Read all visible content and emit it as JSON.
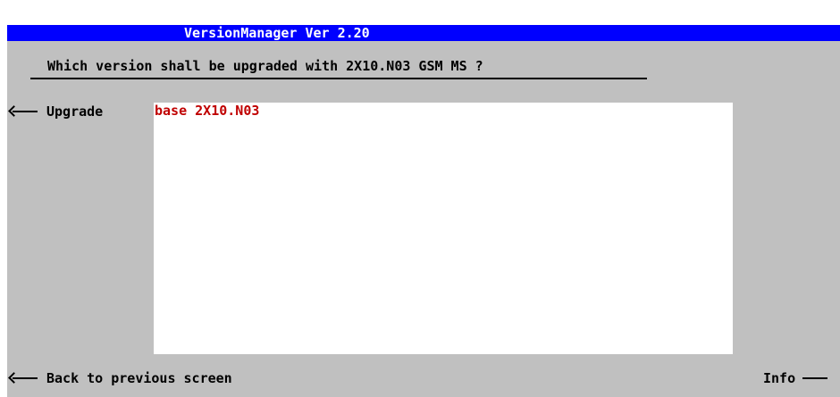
{
  "window": {
    "title": "VersionManager Ver 2.20"
  },
  "prompt": {
    "question": "Which version shall be upgraded with 2X10.N03 GSM MS ?"
  },
  "softkeys": {
    "upgrade_label": "Upgrade",
    "back_label": "Back to previous screen",
    "info_label": "Info"
  },
  "version_list": {
    "items": [
      {
        "label": "base 2X10.N03"
      }
    ]
  },
  "colors": {
    "title_bar": "#0000ff",
    "panel": "#c0c0c0",
    "list_background": "#ffffff",
    "selected_item_text": "#c00000"
  }
}
